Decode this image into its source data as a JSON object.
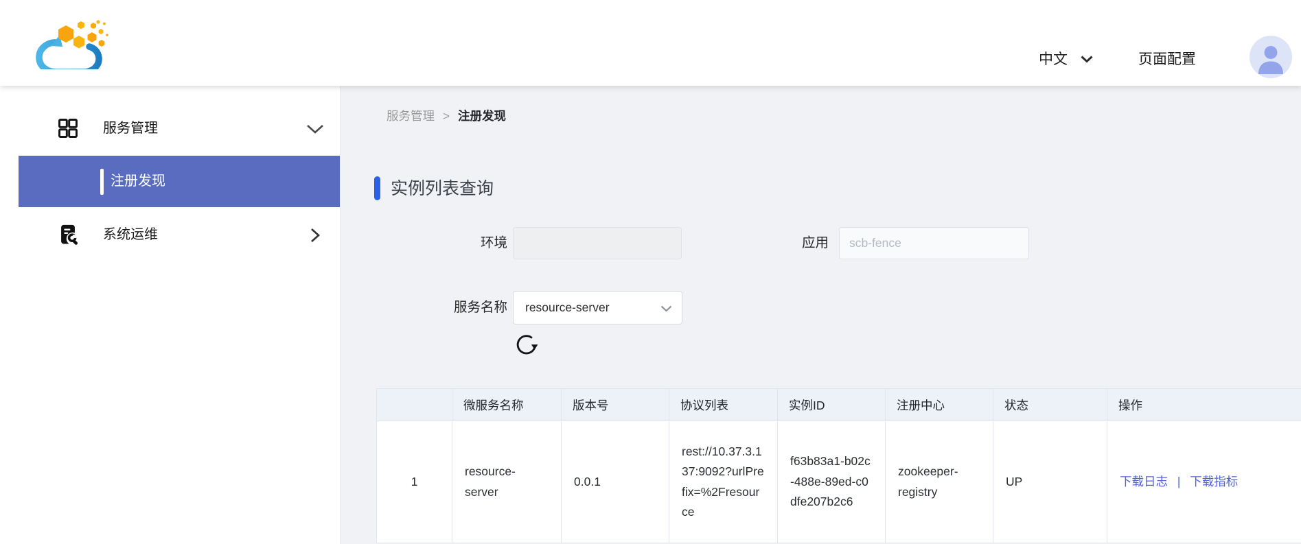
{
  "header": {
    "language_label": "中文",
    "page_config_label": "页面配置"
  },
  "sidebar": {
    "service_mgmt_label": "服务管理",
    "registry_discovery_label": "注册发现",
    "system_ops_label": "系统运维"
  },
  "breadcrumb": {
    "parent": "服务管理",
    "separator": ">",
    "current": "注册发现"
  },
  "section": {
    "title": "实例列表查询"
  },
  "form": {
    "env_label": "环境",
    "env_value": "",
    "app_label": "应用",
    "app_placeholder": "scb-fence",
    "service_name_label": "服务名称",
    "service_name_value": "resource-server"
  },
  "table": {
    "headers": [
      "",
      "微服务名称",
      "版本号",
      "协议列表",
      "实例ID",
      "注册中心",
      "状态",
      "操作"
    ],
    "rows": [
      {
        "index": "1",
        "service_name": "resource-server",
        "version": "0.0.1",
        "protocol_list": "rest://10.37.3.137:9092?urlPrefix=%2Fresource",
        "instance_id": "f63b83a1-b02c-488e-89ed-c0dfe207b2c6",
        "registry": "zookeeper-registry",
        "status": "UP",
        "action_download_log": "下载日志",
        "action_separator": "|",
        "action_download_metrics": "下载指标"
      }
    ]
  },
  "colors": {
    "accent_blue": "#2b61e6",
    "sidebar_active_bg": "#5a6cc0",
    "link_blue": "#5063d4",
    "table_header_bg": "#edf1f8",
    "content_bg": "#f1f2f5"
  }
}
